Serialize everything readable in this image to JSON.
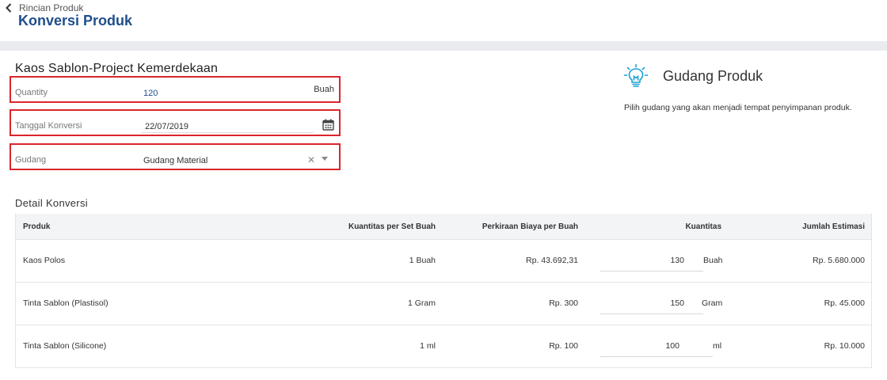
{
  "header": {
    "back_label": "Rincian Produk",
    "title": "Konversi Produk"
  },
  "form": {
    "product_name": "Kaos Sablon-Project Kemerdekaan",
    "quantity": {
      "label": "Quantity",
      "value": "120",
      "unit": "Buah"
    },
    "date": {
      "label": "Tanggal Konversi",
      "value": "22/07/2019"
    },
    "warehouse": {
      "label": "Gudang",
      "value": "Gudang Material"
    }
  },
  "panel": {
    "title": "Gudang Produk",
    "description": "Pilih gudang yang akan menjadi tempat penyimpanan produk."
  },
  "detail": {
    "title": "Detail Konversi",
    "columns": [
      "Produk",
      "Kuantitas per Set Buah",
      "Perkiraan Biaya per Buah",
      "Kuantitas",
      "Jumlah Estimasi"
    ],
    "rows": [
      {
        "product": "Kaos Polos",
        "qty_per_set": "1 Buah",
        "cost": "Rp. 43.692,31",
        "qty": "130",
        "unit": "Buah",
        "total": "Rp. 5.680.000"
      },
      {
        "product": "Tinta Sablon (Plastisol)",
        "qty_per_set": "1 Gram",
        "cost": "Rp. 300",
        "qty": "150",
        "unit": "Gram",
        "total": "Rp. 45.000"
      },
      {
        "product": "Tinta Sablon (Silicone)",
        "qty_per_set": "1 ml",
        "cost": "Rp. 100",
        "qty": "100",
        "unit": "ml",
        "total": "Rp. 10.000"
      }
    ]
  },
  "colors": {
    "title_blue": "#1f4e8c",
    "highlight_red": "#d9262c",
    "bulb_blue": "#1aa0d8"
  }
}
